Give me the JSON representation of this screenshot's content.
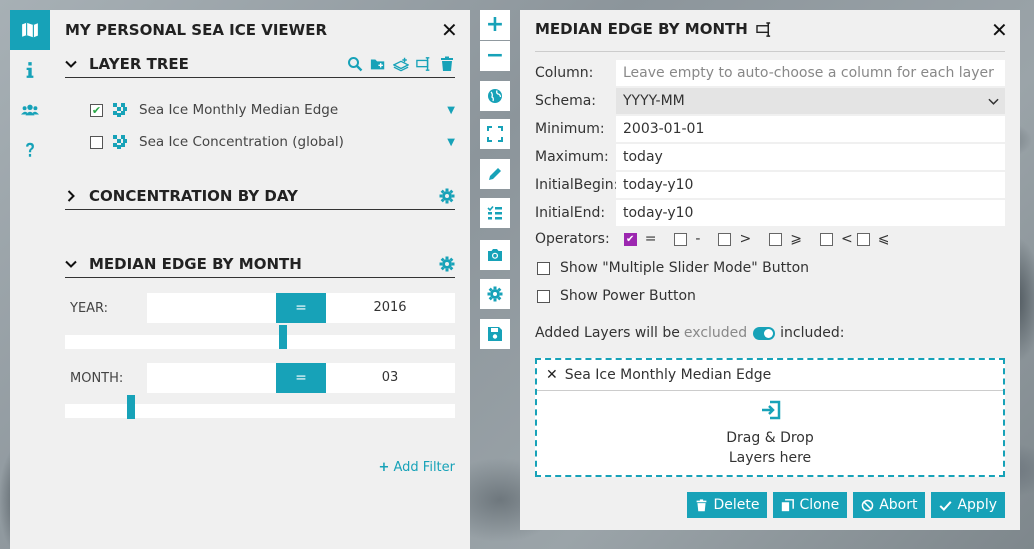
{
  "app": {
    "title": "MY PERSONAL SEA ICE VIEWER",
    "rail": [
      "map-icon",
      "info-icon",
      "users-icon",
      "help-icon"
    ]
  },
  "layer_tree": {
    "title": "LAYER TREE",
    "layers": [
      {
        "name": "Sea Ice Monthly Median Edge",
        "checked": true
      },
      {
        "name": "Sea Ice Concentration (global)",
        "checked": false
      }
    ]
  },
  "sections": {
    "concentration": {
      "title": "CONCENTRATION BY DAY"
    },
    "median": {
      "title": "MEDIAN EDGE BY MONTH"
    }
  },
  "filters": {
    "year": {
      "label": "YEAR:",
      "op": "=",
      "value": "2016",
      "level": 0.56
    },
    "month": {
      "label": "MONTH:",
      "op": "=",
      "value": "03",
      "level": 0.17
    },
    "add_filter": "Add Filter"
  },
  "edit_panel": {
    "title": "MEDIAN EDGE BY MONTH",
    "column_label": "Column:",
    "column_placeholder": "Leave empty to auto-choose a column for each layer",
    "schema_label": "Schema:",
    "schema_value": "YYYY-MM",
    "minimum_label": "Minimum:",
    "minimum_value": "2003-01-01",
    "maximum_label": "Maximum:",
    "maximum_value": "today",
    "initial_begin_label": "InitialBegin:",
    "initial_begin_value": "today-y10",
    "initial_end_label": "InitialEnd:",
    "initial_end_value": "today-y10",
    "operators_label": "Operators:",
    "operators": [
      {
        "symbol": "=",
        "checked": true
      },
      {
        "symbol": "-",
        "checked": false
      },
      {
        "symbol": ">",
        "checked": false
      },
      {
        "symbol": "⩾",
        "checked": false
      },
      {
        "symbol": "<",
        "checked": false
      },
      {
        "symbol": "⩽",
        "checked": false
      }
    ],
    "multi_slider_label": "Show \"Multiple Slider Mode\" Button",
    "power_button_label": "Show Power Button",
    "added_layers_prefix": "Added Layers will be",
    "added_layers_excluded": "excluded",
    "added_layers_included": "included:",
    "drop_layer": "Sea Ice Monthly Median Edge",
    "drop_text_1": "Drag & Drop",
    "drop_text_2": "Layers here",
    "buttons": {
      "delete": "Delete",
      "clone": "Clone",
      "abort": "Abort",
      "apply": "Apply"
    }
  },
  "colors": {
    "accent": "#17a2b8",
    "check_purple": "#9c27b0",
    "check_green": "#28a745"
  }
}
